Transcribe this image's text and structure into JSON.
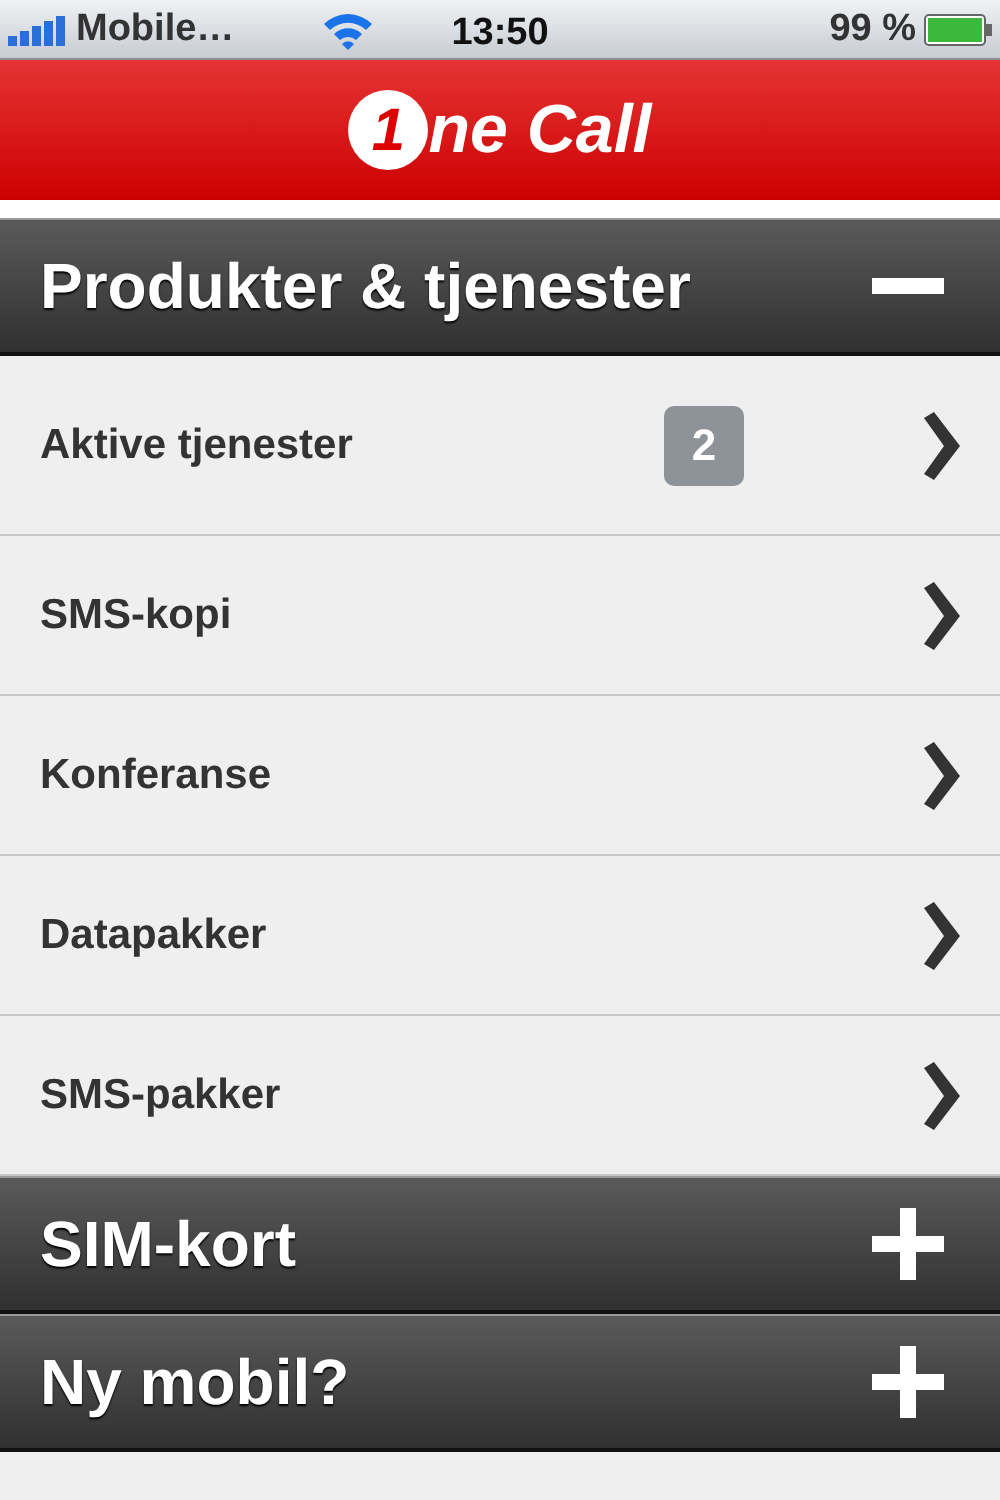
{
  "status_bar": {
    "carrier": "Mobile…",
    "time": "13:50",
    "battery": "99 %"
  },
  "header": {
    "logo_mark": "1",
    "logo_text": "ne Call"
  },
  "sections": [
    {
      "title": "Produkter & tjenester",
      "expanded": true,
      "items": [
        {
          "label": "Aktive tjenester",
          "badge": "2"
        },
        {
          "label": "SMS-kopi"
        },
        {
          "label": "Konferanse"
        },
        {
          "label": "Datapakker"
        },
        {
          "label": "SMS-pakker"
        }
      ]
    },
    {
      "title": "SIM-kort",
      "expanded": false
    },
    {
      "title": "Ny mobil?",
      "expanded": false
    }
  ]
}
